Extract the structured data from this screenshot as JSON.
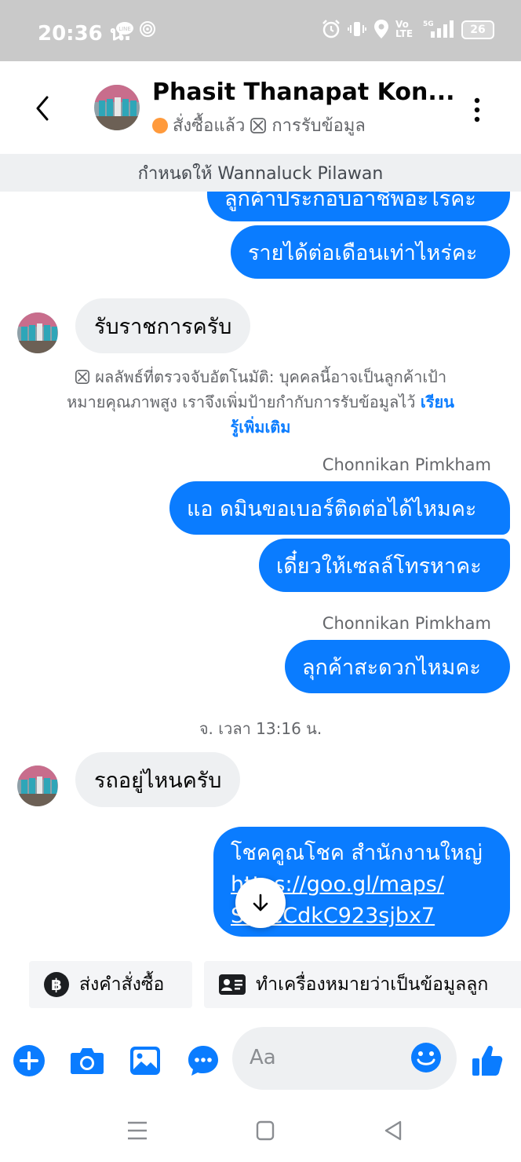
{
  "status_bar": {
    "time": "20:36 น.",
    "network": "5G",
    "volte": "Vo LTE",
    "battery": "26"
  },
  "header": {
    "contact_name": "Phasit Thanapat Kon...",
    "tag_purchased": "สั่งซื้อแล้ว",
    "tag_info": "การรับข้อมูล",
    "icons": [
      "back-icon",
      "avatar",
      "more-vert-icon"
    ]
  },
  "assigned_to": "กำหนดให้ Wannaluck Pilawan",
  "messages": {
    "out_partial": "ลูกค้าประกอบอาชีพอะไรคะ",
    "out_income": "รายได้ต่อเดือนเท่าไหร่คะ",
    "in_govt": "รับราชการครับ",
    "notice_text": "ผลลัพธ์ที่ตรวจจับอัตโนมัติ: บุคคลนี้อาจเป็นลูกค้าเป้าหมายคุณภาพสูง เราจึงเพิ่มป้ายกำกับการรับข้อมูลไว้",
    "notice_link": "เรียนรู้เพิ่มเติม",
    "sender_1": "Chonnikan Pimkham",
    "out_admin": "แอ ดมินขอเบอร์ติดต่อได้ไหมคะ",
    "out_sales": "เดี๋ยวให้เซลล์โทรหาคะ",
    "sender_2": "Chonnikan Pimkham",
    "out_convenient": "ลุกค้าสะดวกไหมคะ",
    "timestamp": "จ. เวลา 13:16 น.",
    "in_where": "รถอยู่ไหนครับ",
    "out_link_line1": "โชคคูณโชค สำนักงานใหญ่",
    "out_link_line2": "https://goo.gl/maps/",
    "out_link_line3": "SuqcCdkC923sjbx7"
  },
  "quick_actions": {
    "send_order": "ส่งคำสั่งซื้อ",
    "mark_info": "ทำเครื่องหมายว่าเป็นข้อมูลลูก"
  },
  "composer": {
    "placeholder": "Aa",
    "icons": [
      "add-icon",
      "camera-icon",
      "gallery-icon",
      "chat-more-icon",
      "emoji-icon",
      "like-icon"
    ]
  },
  "colors": {
    "accent": "#0a7cff",
    "incoming_bubble": "#eef0f2",
    "status_bar": "#c9c9c9",
    "tag_dot": "#ff9a3c"
  }
}
